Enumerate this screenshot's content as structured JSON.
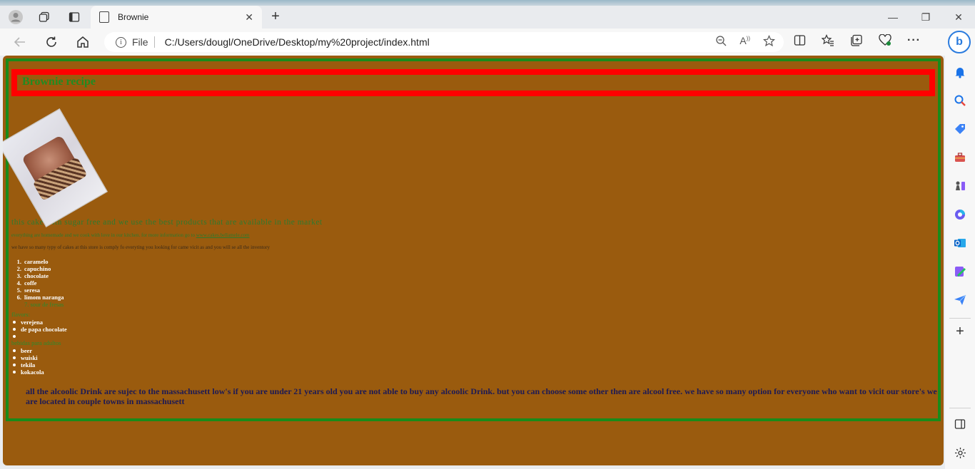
{
  "browser": {
    "tab_title": "Brownie",
    "file_label": "File",
    "url": "C:/Users/dougl/OneDrive/Desktop/my%20project/index.html",
    "bing_label": "b"
  },
  "page": {
    "heading": "Brownie recipe",
    "description": "this cake with sugar free and we use the best products that are available in the market",
    "small_text": "everything are homemade and we cook with love in our kitchen. for more information go to",
    "small_link": "www.cakes.bellamele.com",
    "inventory_text": "we have so many typy of cakes at this store is comply fo everyting you looking for came vicit as and you will se all the inventory",
    "flavors": [
      {
        "num": "1.",
        "label": "caramelo"
      },
      {
        "num": "2.",
        "label": "capuchino"
      },
      {
        "num": "3.",
        "label": "chocolate"
      },
      {
        "num": "4.",
        "label": "coffe"
      },
      {
        "num": "5.",
        "label": "seresa"
      },
      {
        "num": "6.",
        "label": "limom naranga"
      }
    ],
    "flavor_extra": "7. sour de fresas",
    "section1_label": "flavors:",
    "section1_items": [
      "verejena",
      "de papa chocolate",
      ""
    ],
    "section2_label": "bebidas para adultos",
    "section2_items": [
      "beer",
      "wuiski",
      "tekila",
      "kokacola"
    ],
    "footer": "all the alcoolic Drink are sujec to the massachusett low's if you are under 21 years old you are not able to buy any alcoolic Drink. but you can choose some other then are alcool free. we have so many option for everyone who want to vicit our store's we are located in couple towns in massachusett"
  },
  "colors": {
    "page_bg": "#9a5b0e",
    "border_green": "#1a8a1a",
    "header_red": "#ff0000"
  }
}
